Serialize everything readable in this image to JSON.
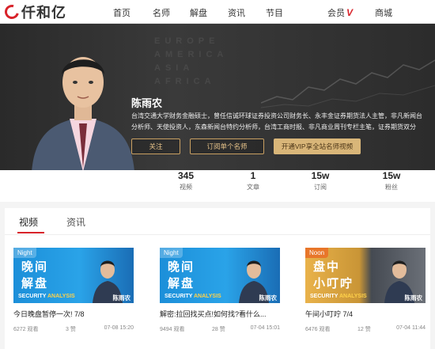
{
  "brand": {
    "logo_text": "仟和亿"
  },
  "nav": {
    "items": [
      "首页",
      "名师",
      "解盘",
      "资讯",
      "节目",
      "会员",
      "商城"
    ],
    "vip_mark": "V"
  },
  "hero": {
    "name": "陈雨农",
    "bio_line1": "台湾交通大学财务金融硕士，曾任信诚环球证券投资公司财务长、永丰金证券期货法人主管，非凡新闻台",
    "bio_line2": "分析师、天使投资人，东森新闻台特约分析师，台湾工商时报、非凡商业周刊专栏主笔，证券期货双分",
    "follow_label": "关注",
    "subscribe_label": "订阅单个名师",
    "vip_label": "开通VIP享全站名师视频",
    "bg_text": [
      "EUROPE",
      "AMERICA",
      "ASIA",
      "AFRICA"
    ]
  },
  "stats": [
    {
      "value": "345",
      "label": "视频"
    },
    {
      "value": "1",
      "label": "文章"
    },
    {
      "value": "15w",
      "label": "订阅"
    },
    {
      "value": "15w",
      "label": "粉丝"
    }
  ],
  "tabs": {
    "video": "视频",
    "news": "资讯"
  },
  "cards": [
    {
      "badge": "Night",
      "title1": "晚间",
      "title2": "解盘",
      "sub_a": "SECURITY",
      "sub_b": "ANALYSIS",
      "teacher": "陈雨农",
      "title": "今日晚盘暂停一次! 7/8",
      "views": "6272 观看",
      "likes": "3 赞",
      "date": "07-08 15:20"
    },
    {
      "badge": "Night",
      "title1": "晚间",
      "title2": "解盘",
      "sub_a": "SECURITY",
      "sub_b": "ANALYSIS",
      "teacher": "陈雨农",
      "title": "解密:拉回找买点!如何找?看什么...",
      "views": "9494 观看",
      "likes": "28 赞",
      "date": "07-04 15:01"
    },
    {
      "badge": "Noon",
      "title1": "盘中",
      "title2": "小叮咛",
      "sub_a": "SECURITY",
      "sub_b": "ANALYSIS",
      "teacher": "陈雨农",
      "title": "午间小叮咛 7/4",
      "views": "6476 观看",
      "likes": "12 赞",
      "date": "07-04 11:44"
    }
  ]
}
